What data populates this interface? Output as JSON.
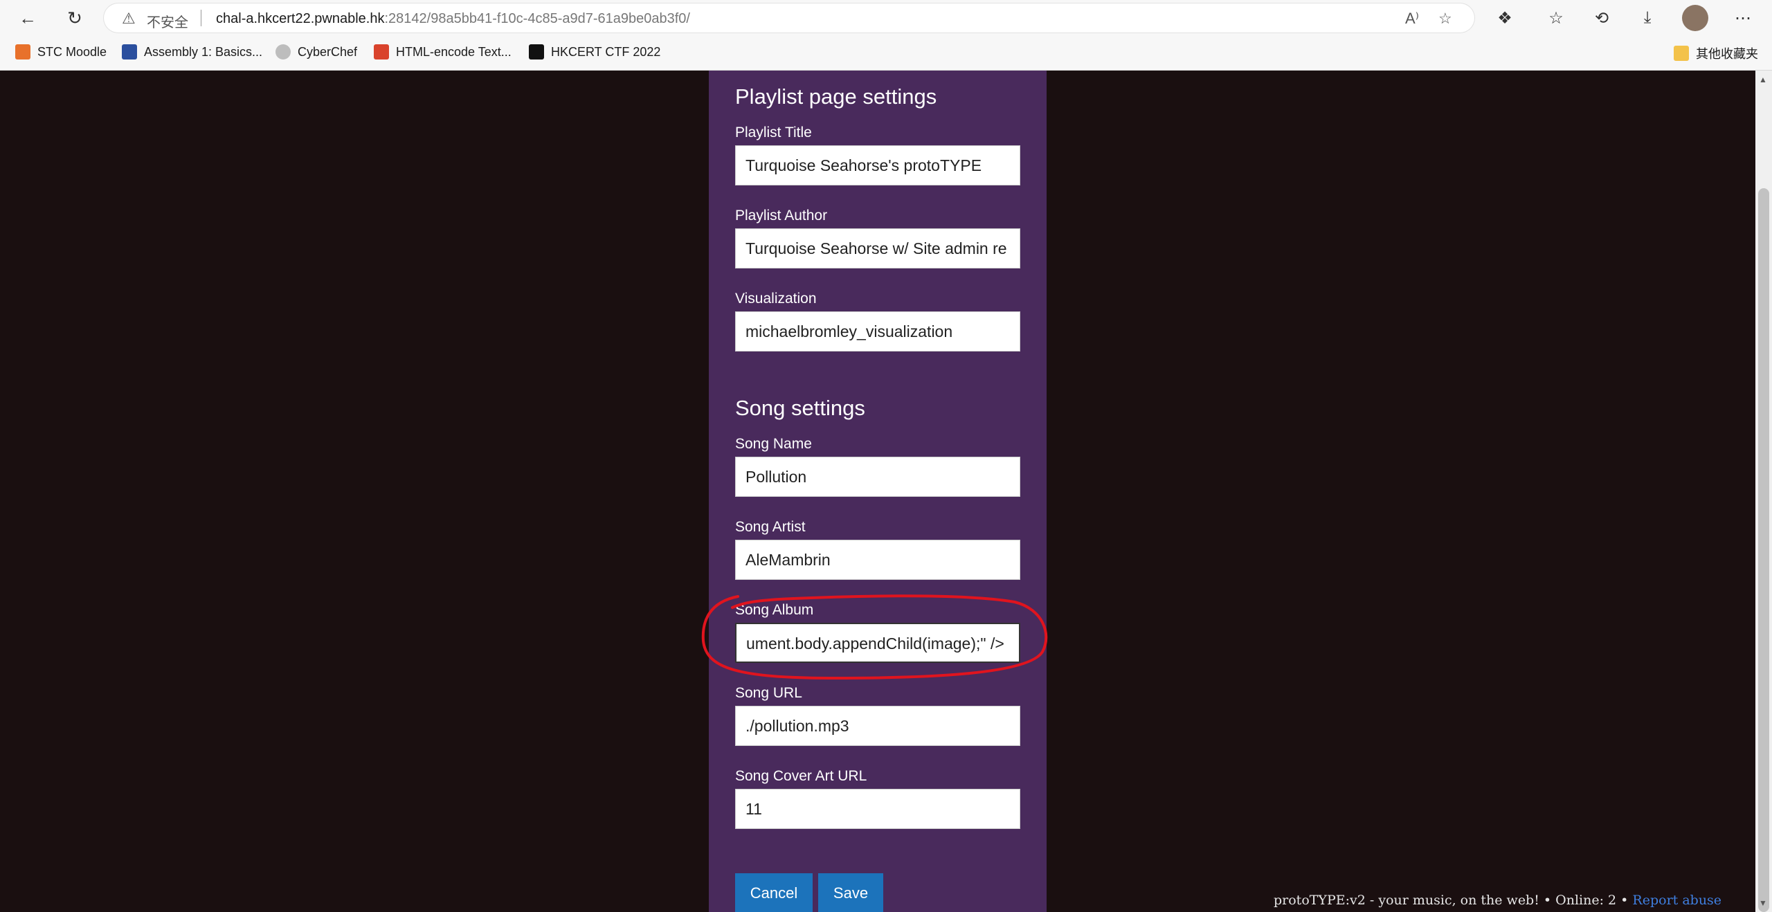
{
  "browser": {
    "security_label": "不安全",
    "url_host": "chal-a.hkcert22.pwnable.hk",
    "url_path": ":28142/98a5bb41-f10c-4c85-a9d7-61a9be0ab3f0/",
    "bookmarks": [
      {
        "label": "STC Moodle",
        "color": "#e8712b"
      },
      {
        "label": "Assembly 1: Basics...",
        "color": "#2b4f9e"
      },
      {
        "label": "CyberChef",
        "color": "#bdbdbd"
      },
      {
        "label": "HTML-encode Text...",
        "color": "#d9432c"
      },
      {
        "label": "HKCERT CTF 2022",
        "color": "#111111"
      }
    ],
    "other_favorites": "其他收藏夹"
  },
  "playlist": {
    "heading": "Playlist page settings",
    "title_label": "Playlist Title",
    "title_value": "Turquoise Seahorse's protoTYPE",
    "author_label": "Playlist Author",
    "author_value": "Turquoise Seahorse w/ Site admin re",
    "viz_label": "Visualization",
    "viz_value": "michaelbromley_visualization"
  },
  "song": {
    "heading": "Song settings",
    "name_label": "Song Name",
    "name_value": "Pollution",
    "artist_label": "Song Artist",
    "artist_value": "AleMambrin",
    "album_label": "Song Album",
    "album_value": "ument.body.appendChild(image);\" />",
    "url_label": "Song URL",
    "url_value": "./pollution.mp3",
    "cover_label": "Song Cover Art URL",
    "cover_value": "11"
  },
  "buttons": {
    "cancel": "Cancel",
    "save": "Save"
  },
  "footer": {
    "text": "protoTYPE:v2 - your music, on the web! • Online: 2 • ",
    "report": "Report abuse"
  },
  "colors": {
    "panel": "#492a5c",
    "button": "#1c73bb",
    "annotation": "#e0141e"
  }
}
